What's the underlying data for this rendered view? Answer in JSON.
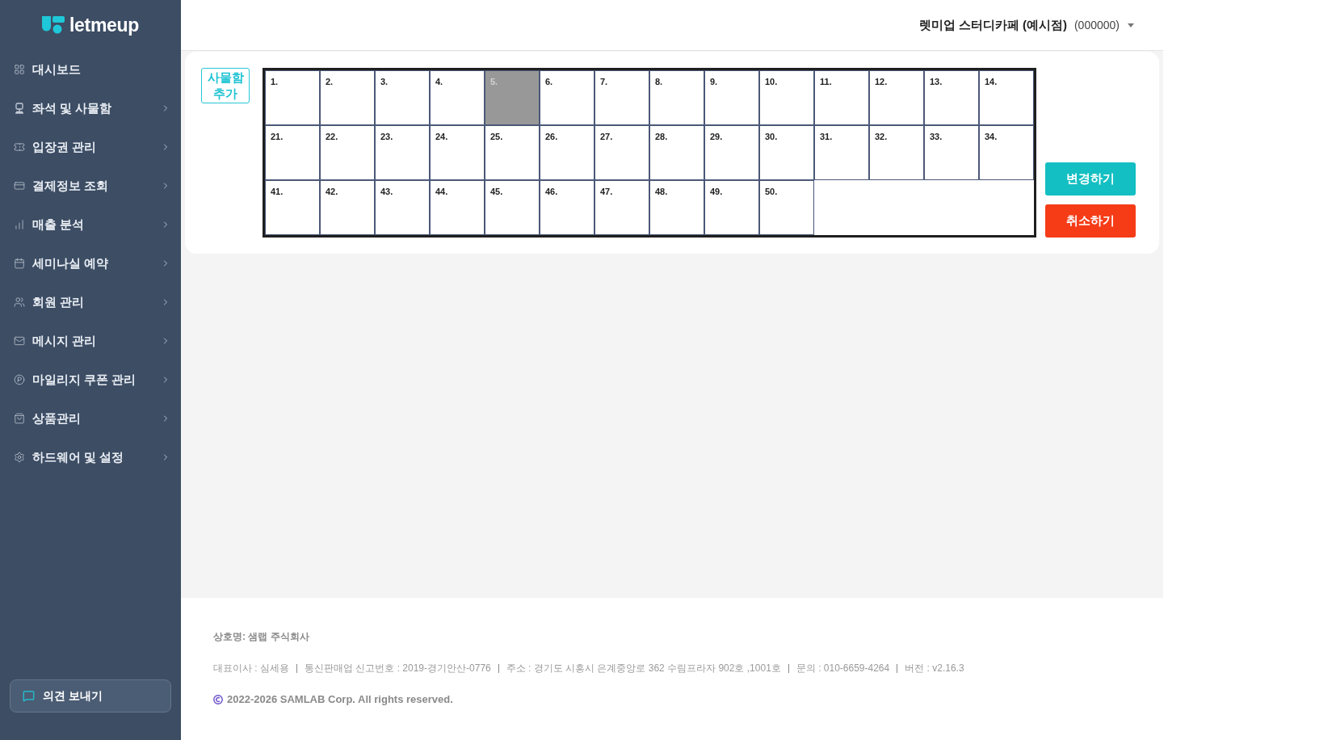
{
  "sidebar": {
    "logo": "letmeup",
    "items": [
      {
        "label": "대시보드",
        "kind": "link"
      },
      {
        "label": "좌석 및 사물함",
        "kind": "group"
      },
      {
        "label": "입장권 관리",
        "kind": "group"
      },
      {
        "label": "결제정보 조회",
        "kind": "group"
      },
      {
        "label": "매출 분석",
        "kind": "group"
      },
      {
        "label": "세미나실 예약",
        "kind": "group"
      },
      {
        "label": "회원 관리",
        "kind": "group"
      },
      {
        "label": "메시지 관리",
        "kind": "group"
      },
      {
        "label": "마일리지 쿠폰 관리",
        "kind": "group"
      },
      {
        "label": "상품관리",
        "kind": "group"
      },
      {
        "label": "하드웨어 및 설정",
        "kind": "group"
      }
    ],
    "feedback_button": "의견 보내기"
  },
  "header": {
    "store_name": "렛미업 스터디카페 (예시점)",
    "store_code": "(000000)"
  },
  "locker_panel": {
    "add_button": "사물함 추가",
    "rows": [
      {
        "cells": [
          {
            "label": "1.",
            "selected": false
          },
          {
            "label": "2.",
            "selected": false
          },
          {
            "label": "3.",
            "selected": false
          },
          {
            "label": "4.",
            "selected": false
          },
          {
            "label": "5.",
            "selected": true
          },
          {
            "label": "6.",
            "selected": false
          },
          {
            "label": "7.",
            "selected": false
          },
          {
            "label": "8.",
            "selected": false
          },
          {
            "label": "9.",
            "selected": false
          },
          {
            "label": "10.",
            "selected": false
          },
          {
            "label": "11.",
            "selected": false
          },
          {
            "label": "12.",
            "selected": false
          },
          {
            "label": "13.",
            "selected": false
          },
          {
            "label": "14.",
            "selected": false
          }
        ]
      },
      {
        "cells": [
          {
            "label": "21.",
            "selected": false
          },
          {
            "label": "22.",
            "selected": false
          },
          {
            "label": "23.",
            "selected": false
          },
          {
            "label": "24.",
            "selected": false
          },
          {
            "label": "25.",
            "selected": false
          },
          {
            "label": "26.",
            "selected": false
          },
          {
            "label": "27.",
            "selected": false
          },
          {
            "label": "28.",
            "selected": false
          },
          {
            "label": "29.",
            "selected": false
          },
          {
            "label": "30.",
            "selected": false
          },
          {
            "label": "31.",
            "selected": false
          },
          {
            "label": "32.",
            "selected": false
          },
          {
            "label": "33.",
            "selected": false
          },
          {
            "label": "34.",
            "selected": false
          }
        ]
      },
      {
        "cells": [
          {
            "label": "41.",
            "selected": false
          },
          {
            "label": "42.",
            "selected": false
          },
          {
            "label": "43.",
            "selected": false
          },
          {
            "label": "44.",
            "selected": false
          },
          {
            "label": "45.",
            "selected": false
          },
          {
            "label": "46.",
            "selected": false
          },
          {
            "label": "47.",
            "selected": false
          },
          {
            "label": "48.",
            "selected": false
          },
          {
            "label": "49.",
            "selected": false
          },
          {
            "label": "50.",
            "selected": false
          }
        ]
      }
    ],
    "buttons": [
      {
        "label": "변경하기",
        "kind": "primary"
      },
      {
        "label": "취소하기",
        "kind": "danger"
      }
    ]
  },
  "footer": {
    "company": "상호명: 샘랩 주식회사",
    "info": [
      "대표이사 : 심세용",
      "통신판매업 신고번호 : 2019-경기안산-0776",
      "주소 : 경기도 시흥시 은계중앙로 362 수림프라자 902호 ,1001호",
      "문의 : 010-6659-4264",
      "버전 : v2.16.3"
    ],
    "copyright": "2022-2026 SAMLAB Corp. All rights reserved."
  }
}
